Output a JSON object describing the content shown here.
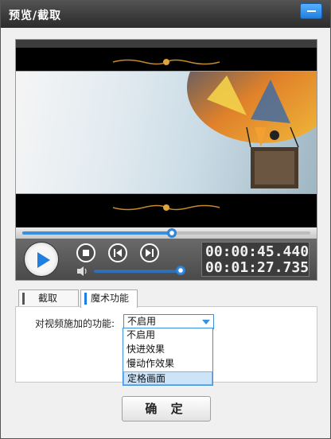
{
  "window": {
    "title": "预览/截取"
  },
  "player": {
    "current_time": "00:00:45.440",
    "total_time": "00:01:27.735",
    "progress": 0.52,
    "volume": 0.95
  },
  "tabs": [
    {
      "label": "截取",
      "active": false
    },
    {
      "label": "魔术功能",
      "active": true
    }
  ],
  "effect": {
    "label": "对视频施加的功能:",
    "selected": "不启用",
    "options": [
      "不启用",
      "快进效果",
      "慢动作效果",
      "定格画面"
    ],
    "highlighted_option": "定格画面"
  },
  "ok_button": "确 定",
  "colors": {
    "accent": "#1f7fe0",
    "title_bar": "#3a3a3a"
  }
}
